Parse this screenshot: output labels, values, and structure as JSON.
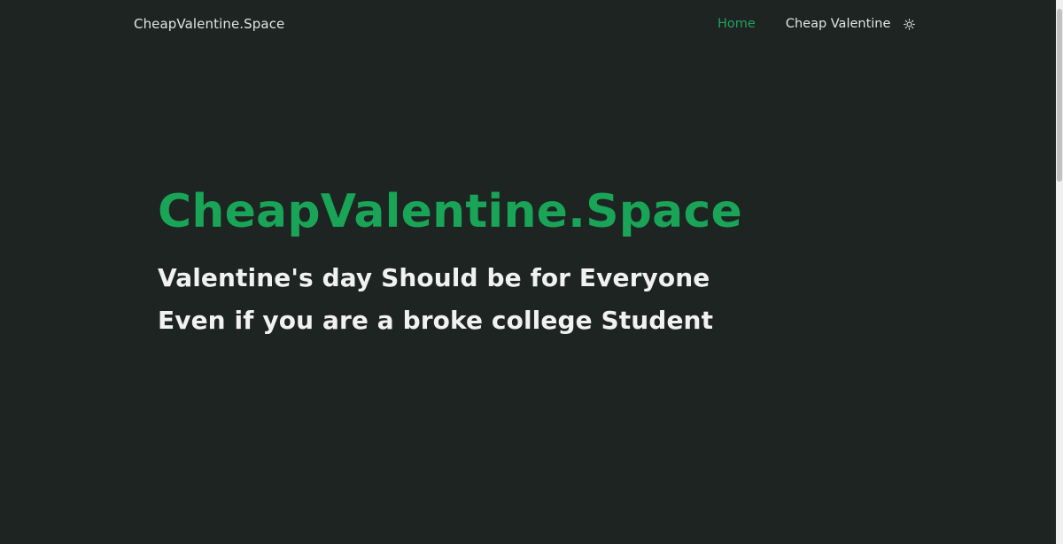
{
  "header": {
    "brand": "CheapValentine.Space",
    "nav": [
      {
        "label": "Home",
        "active": true
      },
      {
        "label": "Cheap Valentine",
        "active": false
      }
    ],
    "theme_toggle_icon": "sun-icon"
  },
  "hero": {
    "title": "CheapValentine.Space",
    "lines": [
      "Valentine's day Should be for Everyone",
      "Even if you are a broke college Student"
    ]
  },
  "colors": {
    "background": "#1d2421",
    "accent": "#19a457",
    "text": "#f1f1f1"
  }
}
